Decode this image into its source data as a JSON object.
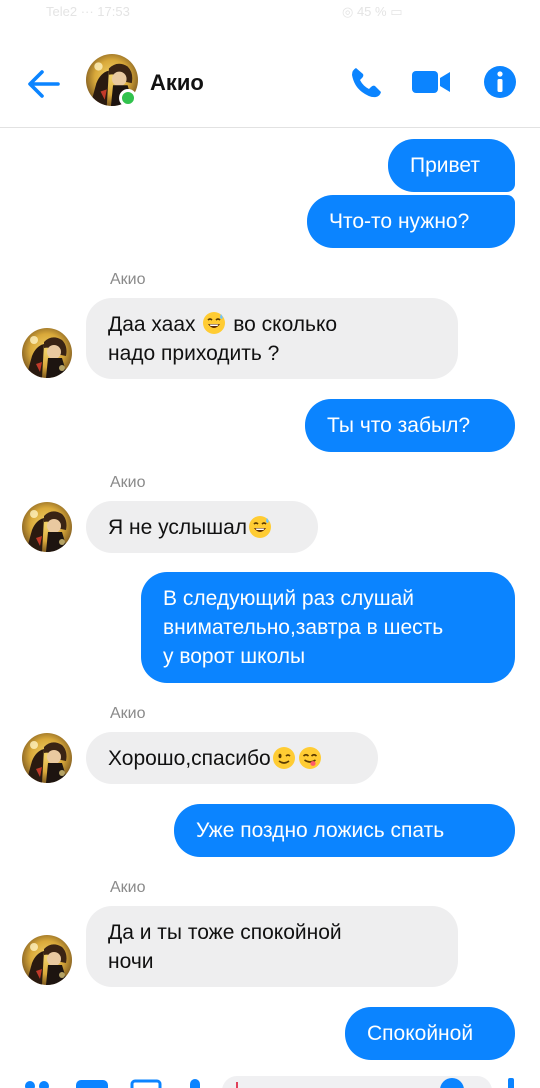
{
  "status_bar": {
    "left": "Tele2 ··· 17:53",
    "right": "◎ 45 % ▭"
  },
  "header": {
    "contact_name": "Акио",
    "back_icon": "arrow-left-icon",
    "call_icon": "phone-icon",
    "video_icon": "video-camera-icon",
    "info_icon": "info-icon",
    "online": true
  },
  "colors": {
    "accent": "#0b84ff",
    "incoming_bubble": "#eeeeef",
    "online": "#31c24d"
  },
  "messages": [
    {
      "dir": "out",
      "text": "Привет"
    },
    {
      "dir": "out",
      "text": "Что-то нужно?"
    },
    {
      "dir": "in",
      "sender": "Акио",
      "text_a": "Даа хаах",
      "emoji_a": "grinning-sweat-emoji",
      "text_b": " во сколько",
      "line2": "надо приходить ?"
    },
    {
      "dir": "out",
      "text": "Ты что забыл?"
    },
    {
      "dir": "in",
      "sender": "Акио",
      "text": "Я не услышал",
      "emoji": "grinning-sweat-emoji"
    },
    {
      "dir": "out",
      "line1": "В следующий раз слушай",
      "line2": "внимательно,завтра в шесть",
      "line3": "у ворот школы"
    },
    {
      "dir": "in",
      "sender": "Акио",
      "text": "Хорошо,спасибо",
      "emoji_1": "winking-face-emoji",
      "emoji_2": "yum-face-emoji"
    },
    {
      "dir": "out",
      "text": "Уже поздно ложись спать"
    },
    {
      "dir": "in",
      "sender": "Акио",
      "line1": "Да и ты тоже спокойной",
      "line2": "ночи"
    },
    {
      "dir": "out",
      "text": "Спокойной"
    }
  ]
}
